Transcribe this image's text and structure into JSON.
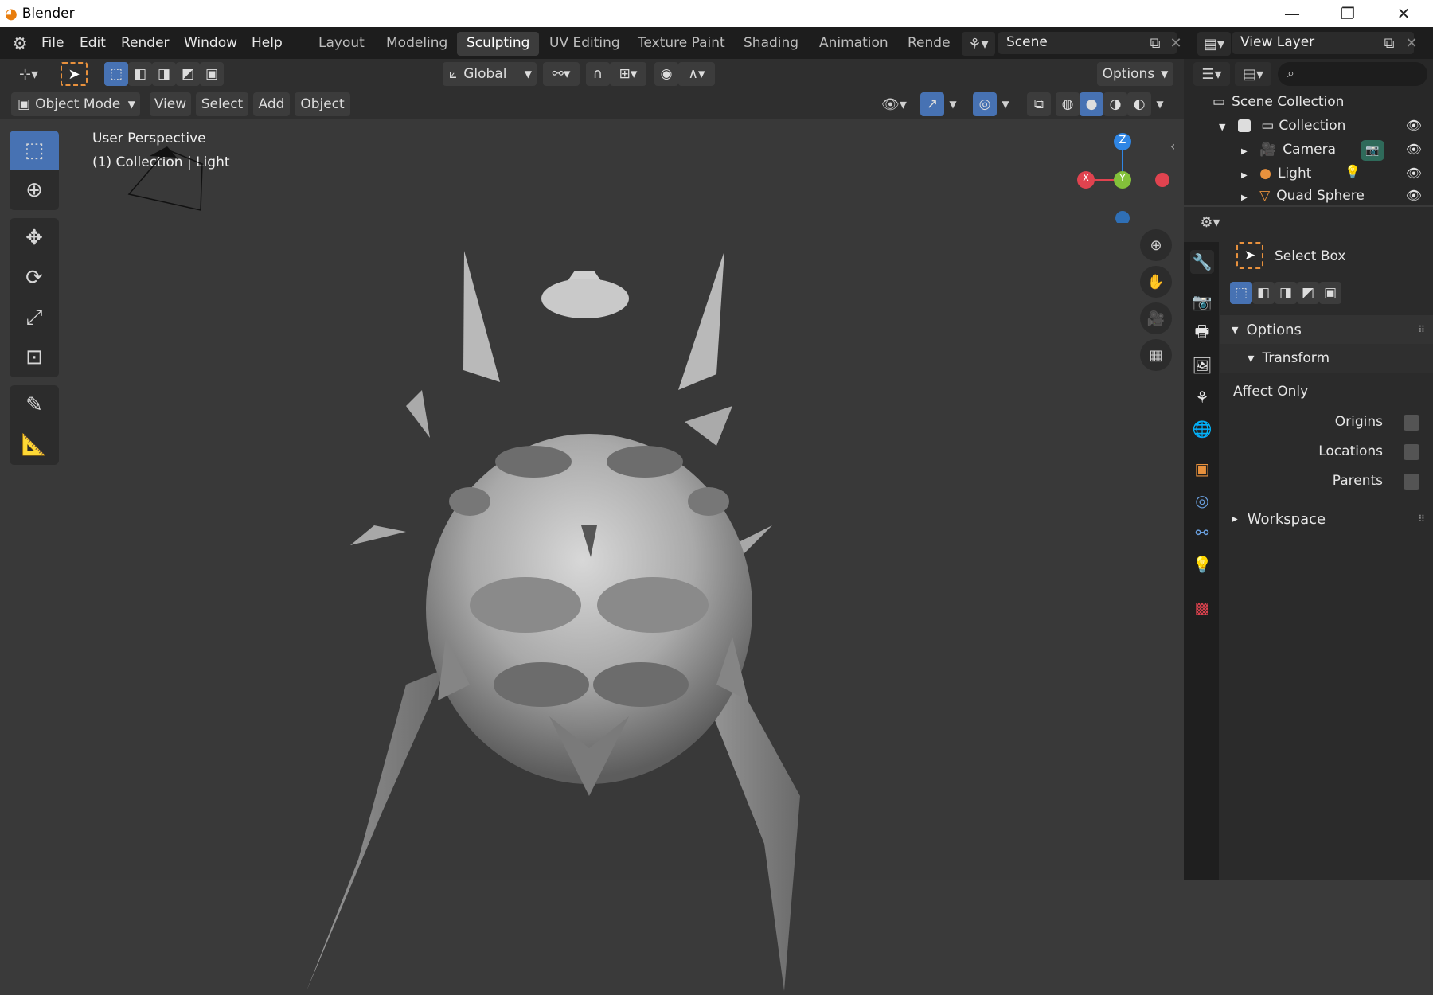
{
  "window": {
    "title": "Blender",
    "minimize": "—",
    "restore": "❐",
    "close": "✕"
  },
  "menu": {
    "file": "File",
    "edit": "Edit",
    "render": "Render",
    "window": "Window",
    "help": "Help"
  },
  "workspaces": [
    "Layout",
    "Modeling",
    "Sculpting",
    "UV Editing",
    "Texture Paint",
    "Shading",
    "Animation",
    "Render"
  ],
  "active_workspace": "Sculpting",
  "scene": {
    "name": "Scene"
  },
  "view_layer": {
    "name": "View Layer"
  },
  "tool_header": {
    "orientation": "Global",
    "options": "Options"
  },
  "viewport_header": {
    "mode": "Object Mode",
    "view": "View",
    "select": "Select",
    "add": "Add",
    "object": "Object"
  },
  "viewport": {
    "perspective": "User Perspective",
    "context": "(1) Collection | Light"
  },
  "gizmo": {
    "z": "Z",
    "x": "X",
    "y": "Y"
  },
  "outliner": {
    "root": "Scene Collection",
    "collection": "Collection",
    "items": [
      "Camera",
      "Light",
      "Quad Sphere"
    ]
  },
  "properties": {
    "tool_name": "Select Box",
    "options_label": "Options",
    "transform_label": "Transform",
    "affect_only": "Affect Only",
    "origins": "Origins",
    "locations": "Locations",
    "parents": "Parents",
    "workspace_label": "Workspace"
  },
  "colors": {
    "accent": "#4772b3",
    "x_axis": "#e0434f",
    "y_axis": "#83c13a",
    "z_axis": "#2f86e5",
    "object_orange": "#e8913d"
  }
}
